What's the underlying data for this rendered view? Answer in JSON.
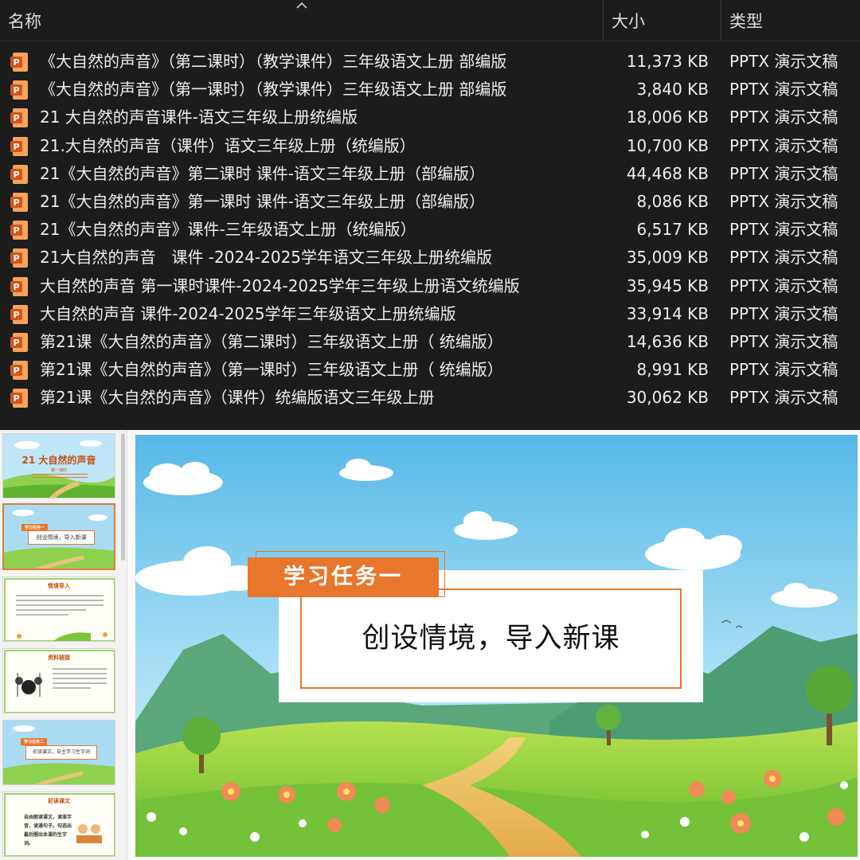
{
  "explorer": {
    "columns": {
      "name": "名称",
      "size": "大小",
      "type": "类型"
    },
    "files": [
      {
        "name": "《大自然的声音》（第二课时）（教学课件）三年级语文上册 部编版",
        "size": "11,373 KB",
        "type": "PPTX 演示文稿"
      },
      {
        "name": "《大自然的声音》（第一课时）（教学课件）三年级语文上册 部编版",
        "size": "3,840 KB",
        "type": "PPTX 演示文稿"
      },
      {
        "name": "21 大自然的声音课件-语文三年级上册统编版",
        "size": "18,006 KB",
        "type": "PPTX 演示文稿"
      },
      {
        "name": "21.大自然的声音（课件）语文三年级上册（统编版）",
        "size": "10,700 KB",
        "type": "PPTX 演示文稿"
      },
      {
        "name": "21《大自然的声音》第二课时 课件-语文三年级上册（部编版）",
        "size": "44,468 KB",
        "type": "PPTX 演示文稿"
      },
      {
        "name": "21《大自然的声音》第一课时 课件-语文三年级上册（部编版）",
        "size": "8,086 KB",
        "type": "PPTX 演示文稿"
      },
      {
        "name": "21《大自然的声音》课件-三年级语文上册（统编版）",
        "size": "6,517 KB",
        "type": "PPTX 演示文稿"
      },
      {
        "name": "21大自然的声音　课件 -2024-2025学年语文三年级上册统编版",
        "size": "35,009 KB",
        "type": "PPTX 演示文稿"
      },
      {
        "name": "大自然的声音 第一课时课件-2024-2025学年三年级上册语文统编版",
        "size": "35,945 KB",
        "type": "PPTX 演示文稿"
      },
      {
        "name": "大自然的声音 课件-2024-2025学年三年级语文上册统编版",
        "size": "33,914 KB",
        "type": "PPTX 演示文稿"
      },
      {
        "name": "第21课《大自然的声音》（第二课时）三年级语文上册（ 统编版）",
        "size": "14,636 KB",
        "type": "PPTX 演示文稿"
      },
      {
        "name": "第21课《大自然的声音》（第一课时）三年级语文上册（ 统编版）",
        "size": "8,991 KB",
        "type": "PPTX 演示文稿"
      },
      {
        "name": "第21课《大自然的声音》（课件）统编版语文三年级上册",
        "size": "30,062 KB",
        "type": "PPTX 演示文稿"
      }
    ],
    "file_icon": "powerpoint-file-icon"
  },
  "thumbnails": {
    "t1_title": "21 大自然的声音",
    "t1_sub": "第一课时",
    "t2_tag": "学习任务一",
    "t2_box": "创设情境，导入新课",
    "t3_title": "情境导入",
    "t4_title": "资料链接",
    "t5_tag": "学习任务二",
    "t5_box": "初读课文，自主学习生字词",
    "t6_title": "初读课文",
    "t6_text": "自由朗读课文，读准字音，读通句子。勾选出最后圈出本课的生字词。"
  },
  "slide": {
    "tag": "学习任务一",
    "headline": "创设情境，导入新课"
  },
  "colors": {
    "accent": "#e8762c",
    "explorer_bg": "#1c1c1c",
    "sky": "#7ec8ec",
    "grass": "#7cc43c"
  }
}
